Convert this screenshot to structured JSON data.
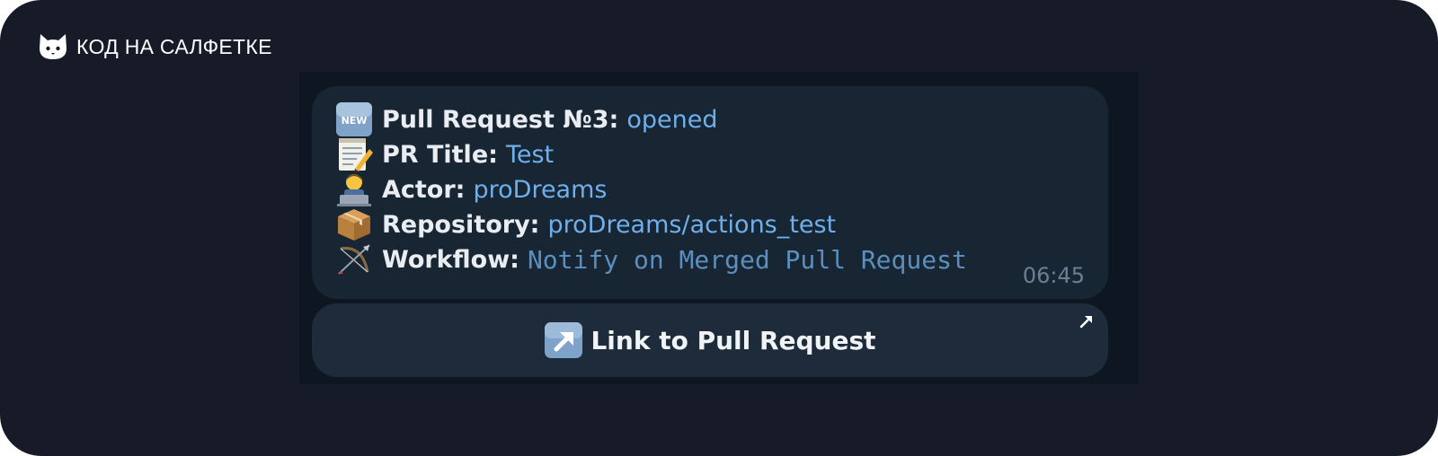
{
  "brand": {
    "name": "КОД НА САЛФЕТКЕ",
    "logo": "cat-head-icon"
  },
  "message": {
    "lines": [
      {
        "icon": "new-badge-icon",
        "label": "Pull Request №3:",
        "value": "opened"
      },
      {
        "icon": "memo-icon",
        "label": "PR Title:",
        "value": "Test"
      },
      {
        "icon": "technologist-icon",
        "label": "Actor:",
        "value": "proDreams"
      },
      {
        "icon": "package-icon",
        "label": "Repository:",
        "value": "proDreams/actions_test"
      },
      {
        "icon": "bow-and-arrow-icon",
        "label": "Workflow:",
        "value": "Notify on Merged Pull Request"
      }
    ],
    "time": "06:45"
  },
  "button": {
    "icon": "up-right-arrow-icon",
    "label": "Link to Pull Request",
    "corner_icon": "external-link-arrow-icon"
  },
  "colors": {
    "frame_bg": "#161b27",
    "chat_bg": "#0e1621",
    "bubble_bg": "#182533",
    "button_bg": "#1d2b3a",
    "link_blue": "#6eb0ec",
    "mono_blue": "#5b8fbf",
    "time_gray": "#6d7f91"
  }
}
